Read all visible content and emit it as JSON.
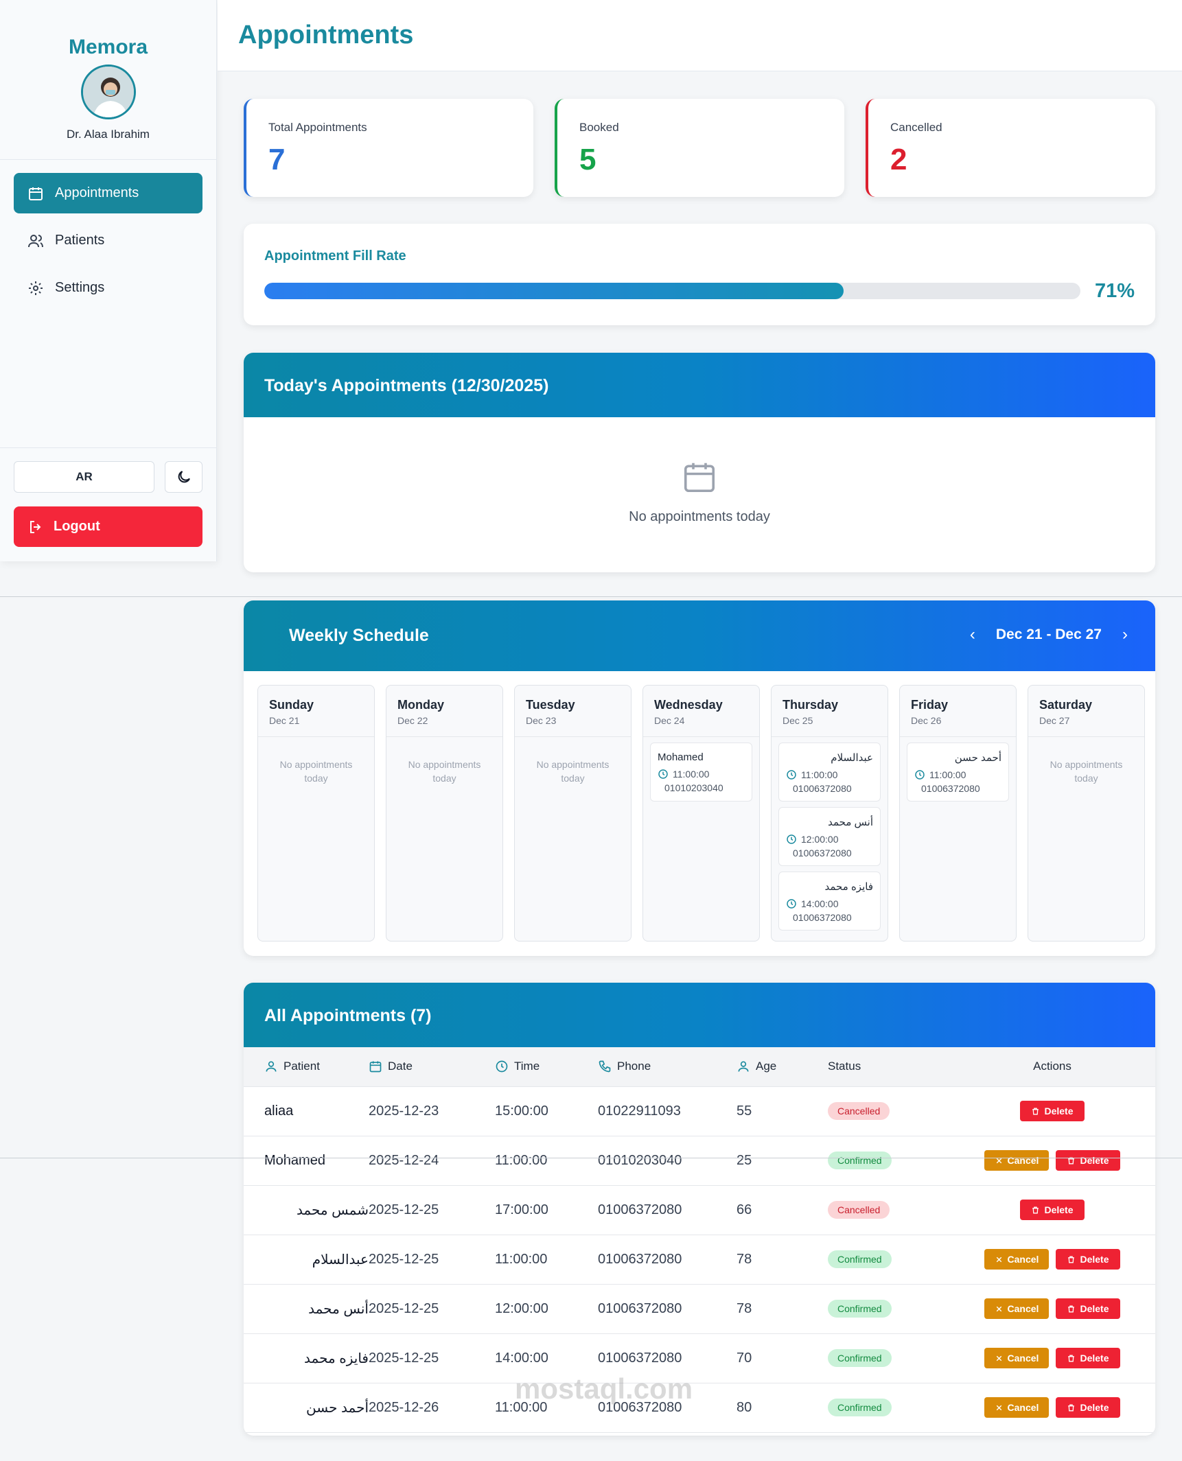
{
  "sidebar": {
    "brand": "Memora",
    "doctor": "Dr. Alaa Ibrahim",
    "nav": [
      {
        "label": "Appointments",
        "icon": "calendar-icon"
      },
      {
        "label": "Patients",
        "icon": "users-icon"
      },
      {
        "label": "Settings",
        "icon": "gear-icon"
      }
    ],
    "lang_label": "AR",
    "logout_label": "Logout"
  },
  "header": {
    "title": "Appointments"
  },
  "stats": [
    {
      "label": "Total Appointments",
      "value": "7",
      "color": "#2a6fd6"
    },
    {
      "label": "Booked",
      "value": "5",
      "color": "#16a34a"
    },
    {
      "label": "Cancelled",
      "value": "2",
      "color": "#dc1f2e"
    }
  ],
  "fill_rate": {
    "title": "Appointment Fill Rate",
    "percent_label": "71%",
    "fraction": 0.71
  },
  "today": {
    "title": "Today's Appointments (12/30/2025)",
    "empty_text": "No appointments today"
  },
  "weekly": {
    "title": "Weekly Schedule",
    "range": "Dec 21 - Dec 27",
    "empty_text": "No appointments today",
    "days": [
      {
        "name": "Sunday",
        "date": "Dec 21",
        "appointments": []
      },
      {
        "name": "Monday",
        "date": "Dec 22",
        "appointments": []
      },
      {
        "name": "Tuesday",
        "date": "Dec 23",
        "appointments": []
      },
      {
        "name": "Wednesday",
        "date": "Dec 24",
        "appointments": [
          {
            "name": "Mohamed",
            "time": "11:00:00",
            "phone": "01010203040"
          }
        ]
      },
      {
        "name": "Thursday",
        "date": "Dec 25",
        "appointments": [
          {
            "name": "عبدالسلام",
            "time": "11:00:00",
            "phone": "01006372080"
          },
          {
            "name": "أنس محمد",
            "time": "12:00:00",
            "phone": "01006372080"
          },
          {
            "name": "فايزه محمد",
            "time": "14:00:00",
            "phone": "01006372080"
          }
        ]
      },
      {
        "name": "Friday",
        "date": "Dec 26",
        "appointments": [
          {
            "name": "أحمد حسن",
            "time": "11:00:00",
            "phone": "01006372080"
          }
        ]
      },
      {
        "name": "Saturday",
        "date": "Dec 27",
        "appointments": []
      }
    ]
  },
  "all": {
    "title": "All Appointments (7)",
    "columns": [
      "Patient",
      "Date",
      "Time",
      "Phone",
      "Age",
      "Status",
      "Actions"
    ],
    "cancel_label": "Cancel",
    "delete_label": "Delete",
    "rows": [
      {
        "patient": "aliaa",
        "date": "2025-12-23",
        "time": "15:00:00",
        "phone": "01022911093",
        "age": "55",
        "status": "Cancelled"
      },
      {
        "patient": "Mohamed",
        "date": "2025-12-24",
        "time": "11:00:00",
        "phone": "01010203040",
        "age": "25",
        "status": "Confirmed"
      },
      {
        "patient": "شمس محمد",
        "date": "2025-12-25",
        "time": "17:00:00",
        "phone": "01006372080",
        "age": "66",
        "status": "Cancelled"
      },
      {
        "patient": "عبدالسلام",
        "date": "2025-12-25",
        "time": "11:00:00",
        "phone": "01006372080",
        "age": "78",
        "status": "Confirmed"
      },
      {
        "patient": "أنس محمد",
        "date": "2025-12-25",
        "time": "12:00:00",
        "phone": "01006372080",
        "age": "78",
        "status": "Confirmed"
      },
      {
        "patient": "فايزه محمد",
        "date": "2025-12-25",
        "time": "14:00:00",
        "phone": "01006372080",
        "age": "70",
        "status": "Confirmed"
      },
      {
        "patient": "أحمد حسن",
        "date": "2025-12-26",
        "time": "11:00:00",
        "phone": "01006372080",
        "age": "80",
        "status": "Confirmed"
      }
    ]
  },
  "watermark": "mostaql.com"
}
